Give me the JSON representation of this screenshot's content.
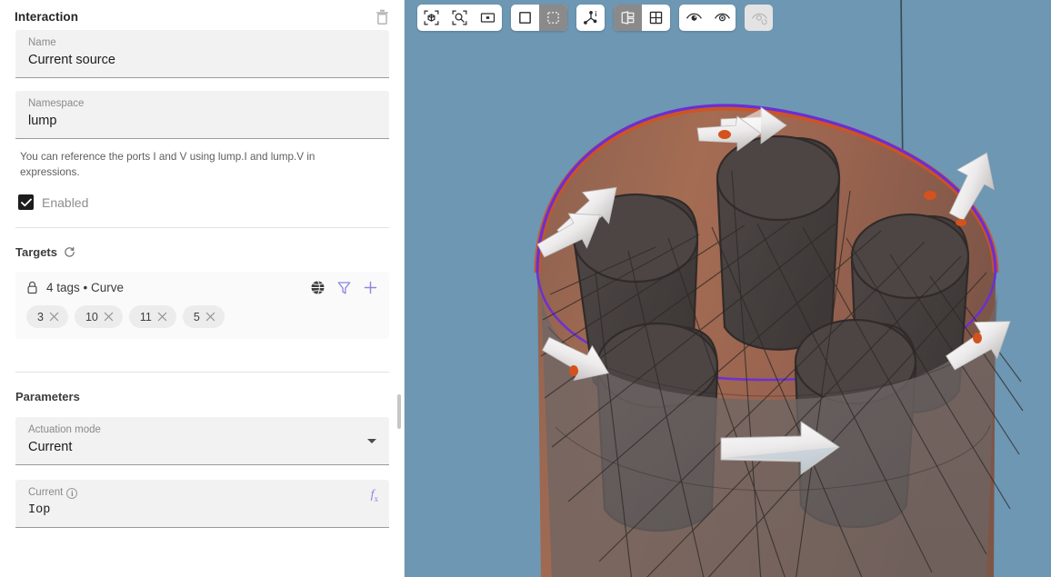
{
  "panel": {
    "title": "Interaction",
    "delete_icon": "trash-icon",
    "fields": {
      "name": {
        "label": "Name",
        "value": "Current source"
      },
      "namespace": {
        "label": "Namespace",
        "value": "lump"
      }
    },
    "hint": "You can reference the ports I and V using lump.I and lump.V in expressions.",
    "enabled": {
      "label": "Enabled",
      "checked": true
    }
  },
  "targets": {
    "title": "Targets",
    "refresh_icon": "refresh-icon",
    "lock_icon": "lock-icon",
    "summary": "4 tags • Curve",
    "actions": [
      {
        "name": "globe-icon",
        "color": "#3f3f3f"
      },
      {
        "name": "filter-icon",
        "color": "#8d86e0"
      },
      {
        "name": "plus-icon",
        "color": "#8d86e0"
      }
    ],
    "tags": [
      "3",
      "10",
      "11",
      "5"
    ],
    "tag_remove_icon": "close-icon"
  },
  "parameters": {
    "title": "Parameters",
    "actuation_mode": {
      "label": "Actuation mode",
      "value": "Current",
      "dropdown_icon": "chevron-down-icon"
    },
    "current": {
      "label": "Current",
      "info_icon": "info-icon",
      "value": "Iop",
      "fx_icon": "fx-icon"
    }
  },
  "viewport": {
    "background_color": "#6d97b3",
    "toolbar": [
      {
        "group": "fit",
        "buttons": [
          {
            "name": "zoom-extents-icon",
            "active": false,
            "disabled": false
          },
          {
            "name": "zoom-selection-icon",
            "active": false,
            "disabled": false
          },
          {
            "name": "zoom-window-icon",
            "active": false,
            "disabled": false
          }
        ]
      },
      {
        "group": "select-mode",
        "buttons": [
          {
            "name": "select-box-icon",
            "active": false,
            "disabled": false
          },
          {
            "name": "select-marquee-icon",
            "active": true,
            "disabled": false
          }
        ]
      },
      {
        "group": "orientation",
        "buttons": [
          {
            "name": "axis-orientation-icon",
            "active": false,
            "disabled": false
          }
        ]
      },
      {
        "group": "layout",
        "buttons": [
          {
            "name": "split-view-icon",
            "active": true,
            "disabled": false
          },
          {
            "name": "grid-view-icon",
            "active": false,
            "disabled": false
          }
        ]
      },
      {
        "group": "visibility",
        "buttons": [
          {
            "name": "show-hidden-icon",
            "active": false,
            "disabled": false
          },
          {
            "name": "hide-icon",
            "active": false,
            "disabled": false
          }
        ]
      },
      {
        "group": "reset-visibility",
        "buttons": [
          {
            "name": "reset-visibility-icon",
            "active": false,
            "disabled": true
          }
        ]
      }
    ],
    "scene": {
      "description": "3D model of a copper coil bundle with current direction arrows",
      "coil_color": "#9b6a52",
      "core_color": "#4a4241",
      "mesh_color": "#6e6a6a",
      "highlight_curve_color": "#6a2fd6",
      "edge_highlight_color": "#d9521e",
      "arrow_color": "#f2f2f2",
      "arrow_count": 8
    }
  }
}
